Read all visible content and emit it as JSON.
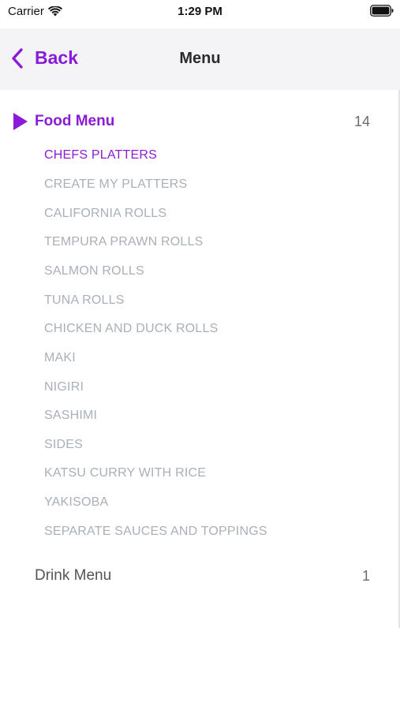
{
  "status_bar": {
    "carrier": "Carrier",
    "time": "1:29 PM",
    "wifi_icon": "wifi-icon",
    "battery_icon": "battery-icon"
  },
  "nav": {
    "back_label": "Back",
    "title": "Menu",
    "back_icon": "chevron-left-icon"
  },
  "colors": {
    "accent": "#8a1bd6",
    "subitem": "#a9b0b8",
    "navbar_bg": "#f4f4f6"
  },
  "menu": {
    "food": {
      "label": "Food Menu",
      "count": "14",
      "expanded": true,
      "items": [
        "CHEFS PLATTERS",
        "CREATE MY PLATTERS",
        "CALIFORNIA ROLLS",
        "TEMPURA PRAWN ROLLS",
        "SALMON ROLLS",
        "TUNA ROLLS",
        "CHICKEN AND DUCK ROLLS",
        "MAKI",
        "NIGIRI",
        "SASHIMI",
        "SIDES",
        "KATSU CURRY WITH RICE",
        "YAKISOBA",
        "SEPARATE SAUCES AND TOPPINGS"
      ],
      "selected_item": "CHEFS PLATTERS"
    },
    "drink": {
      "label": "Drink Menu",
      "count": "1",
      "expanded": false
    }
  }
}
